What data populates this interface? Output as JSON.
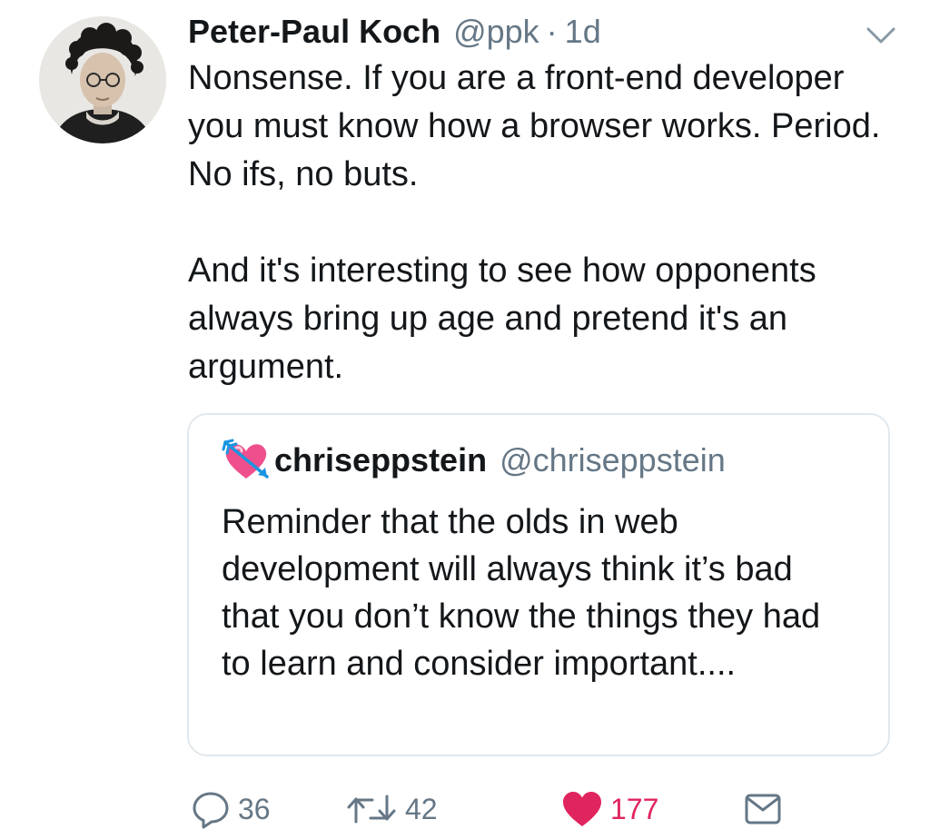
{
  "tweet": {
    "author_name": "Peter-Paul Koch",
    "author_handle": "@ppk",
    "separator": "·",
    "timestamp": "1d",
    "paragraph_1": "Nonsense. If you are a front-end developer you must know how a browser works. Period. No ifs, no buts.",
    "paragraph_2": "And it's interesting to see how opponents always bring up age and pretend it's an argument."
  },
  "quoted_tweet": {
    "author_name": "chriseppstein",
    "author_handle": "@chriseppstein",
    "text": "Reminder that the olds in web development will always think it’s bad that you don’t know the things they had to learn and consider important...."
  },
  "actions": {
    "reply_count": "36",
    "retweet_count": "42",
    "like_count": "177",
    "liked": true
  },
  "icons": {
    "more": "chevron-down-icon",
    "reply": "reply-icon",
    "retweet": "retweet-icon",
    "like": "heart-icon",
    "message": "envelope-icon",
    "emoji": "heart-with-arrow-emoji"
  },
  "colors": {
    "text": "#14171a",
    "secondary": "#657786",
    "like": "#e0245e",
    "border": "#e1e8ed"
  }
}
